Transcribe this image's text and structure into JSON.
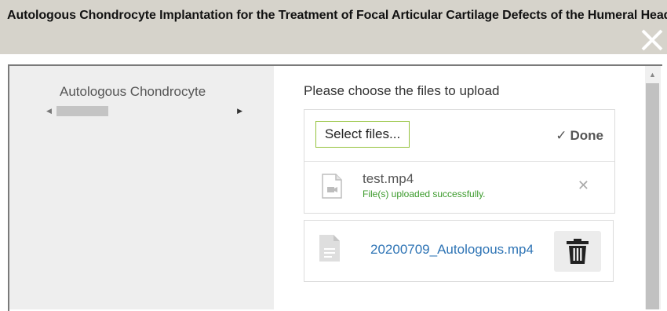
{
  "dialog": {
    "title": "Autologous Chondrocyte Implantation for the Treatment of Focal Articular Cartilage Defects of the Humeral Head",
    "close_icon": "close-icon"
  },
  "left_pane": {
    "label": "Autologous Chondrocyte"
  },
  "upload": {
    "prompt": "Please choose the files to upload",
    "select_label": "Select files...",
    "done_label": "Done",
    "files": [
      {
        "name": "test.mp4",
        "status": "File(s) uploaded successfully.",
        "icon": "video-file-icon"
      }
    ]
  },
  "attachment": {
    "filename": "20200709_Autologous.mp4",
    "icon": "document-icon",
    "delete_icon": "trash-icon"
  },
  "colors": {
    "titlebar_bg": "#d6d3cb",
    "accent_border": "#94c23c",
    "success": "#3a9a2a",
    "link": "#2e74b5"
  }
}
